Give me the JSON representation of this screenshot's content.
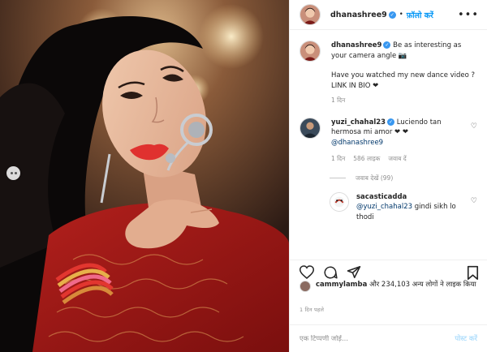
{
  "post": {
    "author": "dhanashree9",
    "follow_label": "फ़ॉलो करें",
    "more_icon": "more-options-icon",
    "dot": "•"
  },
  "caption": {
    "username": "dhanashree9",
    "line1": "Be as interesting as your camera angle 📷",
    "line2": "Have you watched my new dance video ? LINK IN BIO ❤",
    "time": "1 दिन"
  },
  "comments": [
    {
      "username": "yuzi_chahal23",
      "text": "Luciendo tan hermosa mi amor ❤ ❤",
      "mention": "@dhanashree9",
      "time": "1 दिन",
      "likes": "586 लाइक",
      "reply_label": "जवाब दें",
      "view_replies": "जवाब देखें (99)"
    },
    {
      "username": "sacasticadda",
      "mention": "@yuzi_chahal23",
      "text": "gindi sikh lo thodi"
    }
  ],
  "likes": {
    "user": "cammylamba",
    "rest": "और 234,103 अन्य लोगों ने लाइक किया"
  },
  "posted": "1 दिन पहले",
  "comment_box": {
    "placeholder": "एक टिप्पणी जोड़ें...",
    "post_label": "पोस्ट करें"
  },
  "colors": {
    "link": "#0095f6",
    "verified": "#3897f0",
    "muted": "#8e8e8e"
  }
}
